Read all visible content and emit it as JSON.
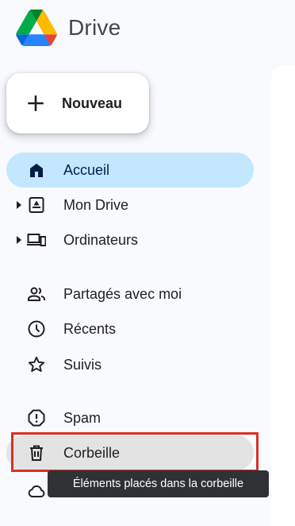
{
  "app": {
    "title": "Drive"
  },
  "new_button": {
    "label": "Nouveau",
    "icon": "plus-icon"
  },
  "nav": {
    "items": [
      {
        "label": "Accueil",
        "icon": "home-icon",
        "active": true
      },
      {
        "label": "Mon Drive",
        "icon": "my-drive-icon",
        "expandable": true
      },
      {
        "label": "Ordinateurs",
        "icon": "computers-icon",
        "expandable": true
      },
      {
        "label": "Partagés avec moi",
        "icon": "shared-people-icon"
      },
      {
        "label": "Récents",
        "icon": "clock-icon"
      },
      {
        "label": "Suivis",
        "icon": "star-icon"
      },
      {
        "label": "Spam",
        "icon": "spam-icon"
      },
      {
        "label": "Corbeille",
        "icon": "trash-icon",
        "hovered": true
      },
      {
        "label": "",
        "icon": "cloud-icon"
      }
    ]
  },
  "tooltip": {
    "text": "Éléments placés dans la corbeille"
  },
  "colors": {
    "active_bg": "#c2e7ff",
    "hover_bg": "#e3e3e3",
    "highlight_border": "#d93025",
    "tooltip_bg": "#303134",
    "sidebar_bg": "#f8fafd"
  }
}
